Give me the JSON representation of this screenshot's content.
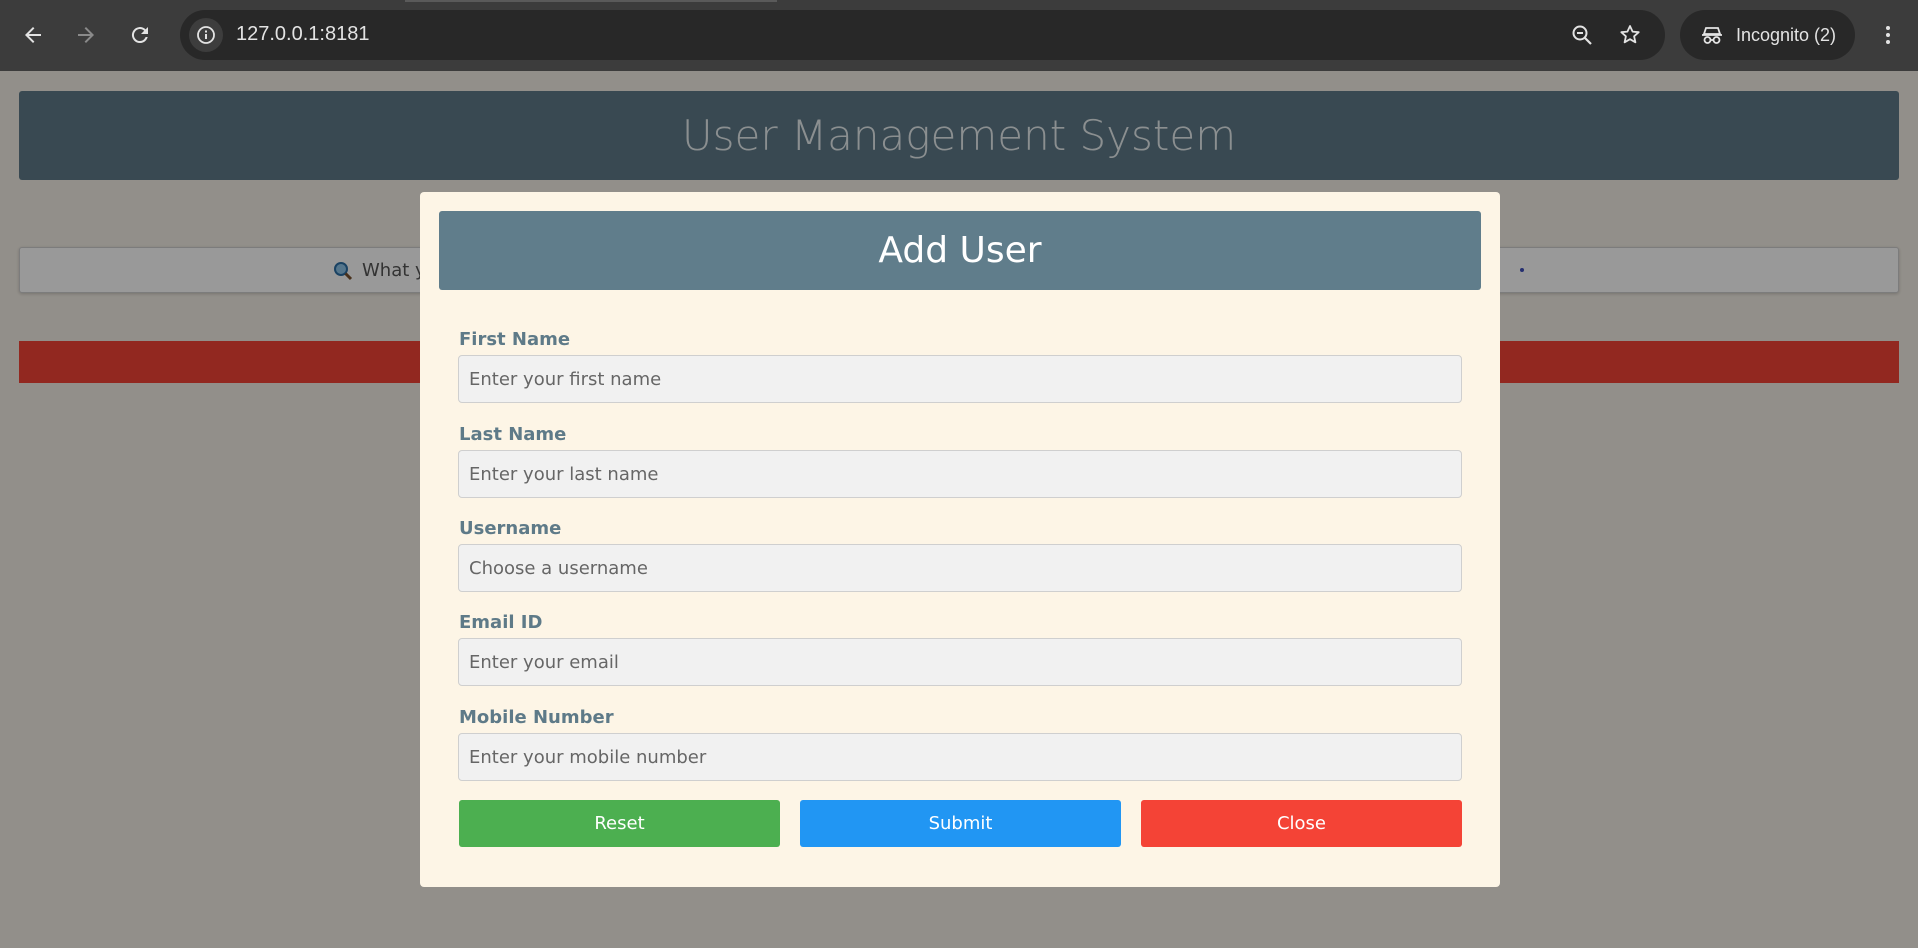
{
  "browser": {
    "url": "127.0.0.1:8181",
    "incognito_label": "Incognito (2)",
    "icons": [
      "back-icon",
      "forward-icon",
      "reload-icon",
      "site-info-icon",
      "zoom-out-icon",
      "bookmark-star-icon",
      "incognito-icon",
      "more-menu-icon"
    ]
  },
  "app": {
    "title": "User Management System",
    "search_text": "What y",
    "search_icon": "magnifier-icon"
  },
  "modal": {
    "title": "Add User",
    "fields": [
      {
        "label": "First Name",
        "placeholder": "Enter your first name"
      },
      {
        "label": "Last Name",
        "placeholder": "Enter your last name"
      },
      {
        "label": "Username",
        "placeholder": "Choose a username"
      },
      {
        "label": "Email ID",
        "placeholder": "Enter your email"
      },
      {
        "label": "Mobile Number",
        "placeholder": "Enter your mobile number"
      }
    ],
    "buttons": {
      "reset": "Reset",
      "submit": "Submit",
      "close": "Close"
    },
    "colors": {
      "reset": "#4caf50",
      "submit": "#2196f3",
      "close": "#f44336",
      "header": "#607d8b",
      "background": "#fdf5e6"
    }
  }
}
